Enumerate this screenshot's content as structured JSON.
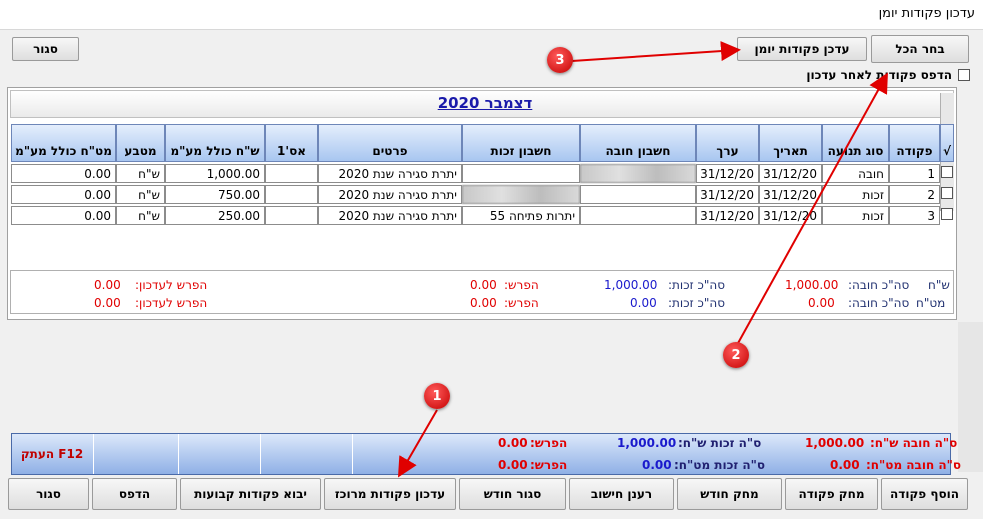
{
  "window": {
    "title": "עדכון פקודות יומן"
  },
  "top_buttons": {
    "close": "סגור",
    "update": "עדכן פקודות יומן",
    "select_all": "בחר הכל"
  },
  "print_option": {
    "label": "הדפס פקודות לאחר עדכון",
    "checked": false
  },
  "month_title": "דצמבר 2020",
  "table": {
    "headers": {
      "check": "√",
      "entry": "פקודה",
      "type": "סוג תנועה",
      "date": "תאריך",
      "value": "ערך",
      "debit": "חשבון חובה",
      "credit": "חשבון זכות",
      "details": "פרטים",
      "ref": "אס'1",
      "nis": "ש\"ח כולל מע\"מ",
      "currency": "מטבע",
      "fx": "מט\"ח כולל מע\"מ"
    },
    "rows": [
      {
        "entry": "1",
        "type": "חובה",
        "date": "31/12/20",
        "value": "31/12/20",
        "debit": "",
        "credit": "",
        "details": "יתרת סגירה שנת 2020",
        "ref": "",
        "nis": "1,000.00",
        "currency": "ש\"ח",
        "fx": "0.00"
      },
      {
        "entry": "2",
        "type": "זכות",
        "date": "31/12/20",
        "value": "31/12/20",
        "debit": "",
        "credit": "",
        "details": "יתרת סגירה שנת 2020",
        "ref": "",
        "nis": "750.00",
        "currency": "ש\"ח",
        "fx": "0.00"
      },
      {
        "entry": "3",
        "type": "זכות",
        "date": "31/12/20",
        "value": "31/12/20",
        "debit": "",
        "credit": "יתרות פתיחה  55",
        "details": "יתרת סגירה שנת 2020",
        "ref": "",
        "nis": "250.00",
        "currency": "ש\"ח",
        "fx": "0.00"
      }
    ]
  },
  "summary": {
    "nis_label": "ש\"ח",
    "fx_label": "מט\"ח",
    "debit_label": "סה\"כ חובה:",
    "credit_label": "סה\"כ זכות:",
    "diff_label": "הפרש:",
    "diff_update_label": "הפרש לעדכון:",
    "nis": {
      "debit": "1,000.00",
      "credit": "1,000.00",
      "diff": "0.00",
      "diff_update": "0.00"
    },
    "fx": {
      "debit": "0.00",
      "credit": "0.00",
      "diff": "0.00",
      "diff_update": "0.00"
    }
  },
  "bottom_totals": {
    "debit_nis_label": "ס\"ה חובה ש\"ח:",
    "debit_nis": "1,000.00",
    "debit_fx_label": "ס\"ה חובה מט\"ח:",
    "debit_fx": "0.00",
    "credit_nis_label": "ס\"ה זכות ש\"ח:",
    "credit_nis": "1,000.00",
    "credit_fx_label": "ס\"ה זכות מט\"ח:",
    "credit_fx": "0.00",
    "diff_label": "הפרש:",
    "diff1": "0.00",
    "diff2": "0.00",
    "copy_button": "העתק F12"
  },
  "bottom_buttons": {
    "add": "הוסף פקודה",
    "delete": "מחק פקודה",
    "delete_month": "מחק חודש",
    "refresh": "רענן חישוב",
    "close_month": "סגור חודש",
    "update_central": "עדכון פקודות מרוכז",
    "import_fixed": "יבוא פקודות קבועות",
    "print": "הדפס",
    "close": "סגור"
  },
  "callouts": [
    "1",
    "2",
    "3"
  ],
  "colors": {
    "callout": "#d40000",
    "header": "#a8c6f0",
    "red_text": "#e00000",
    "blue_text": "#1a1acc"
  }
}
